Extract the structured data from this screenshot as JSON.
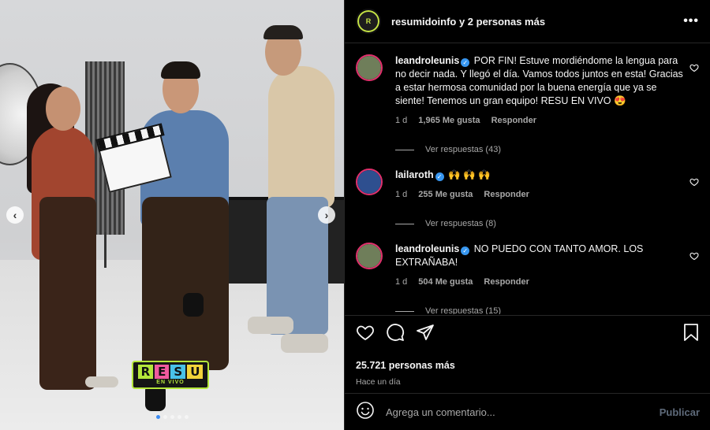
{
  "post": {
    "logo": {
      "letters": [
        "R",
        "E",
        "S",
        "U"
      ],
      "letter_colors": [
        "#b4e63b",
        "#f05a9e",
        "#49c2e8",
        "#f3d33a"
      ],
      "subtitle": "EN VIVO"
    },
    "carousel": {
      "slide_count": 5,
      "active_index": 0
    }
  },
  "header": {
    "author": "resumidoinfo y 2 personas más",
    "avatar_text": "R"
  },
  "comments": [
    {
      "user": "leandroleunis",
      "verified": true,
      "text": "POR FIN! Estuve mordiéndome la lengua para no decir nada. Y llegó el día. Vamos todos juntos en esta! Gracias a estar hermosa comunidad por la buena energía que ya se siente! Tenemos un gran equipo! RESU EN VIVO 😍",
      "time": "1 d",
      "likes": "1,965 Me gusta",
      "reply_label": "Responder",
      "view_replies": "Ver respuestas (43)",
      "avatar_color": "#6f7e5a"
    },
    {
      "user": "lailaroth",
      "verified": true,
      "text": "🙌 🙌 🙌",
      "time": "1 d",
      "likes": "255 Me gusta",
      "reply_label": "Responder",
      "view_replies": "Ver respuestas (8)",
      "avatar_color": "#2e4f8f"
    },
    {
      "user": "leandroleunis",
      "verified": true,
      "text": "NO PUEDO CON TANTO AMOR. LOS EXTRAÑABA!",
      "time": "1 d",
      "likes": "504 Me gusta",
      "reply_label": "Responder",
      "view_replies": "Ver respuestas (15)",
      "avatar_color": "#6f7e5a"
    }
  ],
  "stats": {
    "likes": "25.721 personas más",
    "posted": "Hace un día"
  },
  "composer": {
    "placeholder": "Agrega un comentario...",
    "publish_label": "Publicar"
  },
  "icons": {
    "more": "more-icon",
    "like": "heart-icon",
    "comment": "comment-icon",
    "share": "share-icon",
    "save": "bookmark-icon",
    "emoji": "emoji-icon",
    "prev": "chevron-left-icon",
    "next": "chevron-right-icon"
  },
  "colors": {
    "background": "#000000",
    "divider": "#262626",
    "secondary_text": "#a8a8a8",
    "verified": "#3897f0",
    "story_ring": "#e1306c",
    "carousel_active": "#3b8bf2"
  }
}
